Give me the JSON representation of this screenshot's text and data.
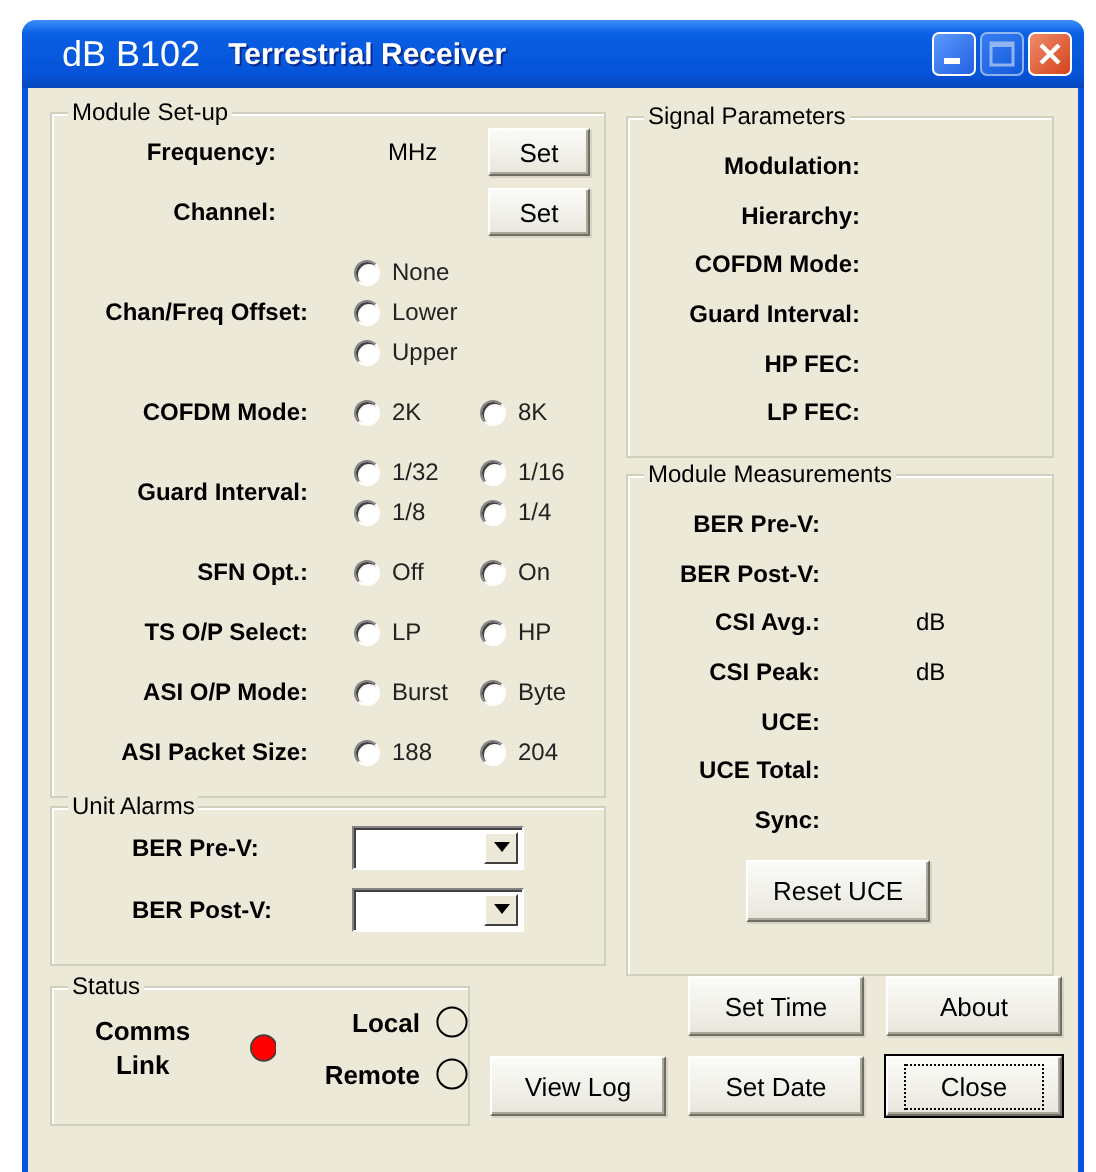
{
  "window": {
    "app_name": "dB B102",
    "title": "Terrestrial Receiver",
    "controls": [
      {
        "kind": "minimize",
        "disabled": false
      },
      {
        "kind": "maximize",
        "disabled": true
      },
      {
        "kind": "close",
        "disabled": false
      }
    ]
  },
  "module_setup": {
    "title": "Module Set-up",
    "rows": [
      {
        "kind": "input",
        "label": "Frequency:",
        "unit": "MHz",
        "button": "Set"
      },
      {
        "kind": "input",
        "label": "Channel:",
        "button": "Set"
      },
      {
        "kind": "radio-stack",
        "label": "Chan/Freq Offset:",
        "options": [
          {
            "label": "None",
            "selected": false
          },
          {
            "label": "Lower",
            "selected": false
          },
          {
            "label": "Upper",
            "selected": false
          }
        ]
      },
      {
        "kind": "radio-grid",
        "label": "COFDM Mode:",
        "options": [
          {
            "label": "2K",
            "selected": false
          },
          {
            "label": "8K",
            "selected": false
          }
        ]
      },
      {
        "kind": "radio-grid",
        "label": "Guard Interval:",
        "options": [
          {
            "label": "1/32",
            "selected": false
          },
          {
            "label": "1/16",
            "selected": false
          },
          {
            "label": "1/8",
            "selected": false
          },
          {
            "label": "1/4",
            "selected": false
          }
        ]
      },
      {
        "kind": "radio-grid",
        "label": "SFN Opt.:",
        "options": [
          {
            "label": "Off",
            "selected": false
          },
          {
            "label": "On",
            "selected": false
          }
        ]
      },
      {
        "kind": "radio-grid",
        "label": "TS O/P Select:",
        "options": [
          {
            "label": "LP",
            "selected": false
          },
          {
            "label": "HP",
            "selected": false
          }
        ]
      },
      {
        "kind": "radio-grid",
        "label": "ASI O/P Mode:",
        "options": [
          {
            "label": "Burst",
            "selected": false
          },
          {
            "label": "Byte",
            "selected": false
          }
        ]
      },
      {
        "kind": "radio-grid",
        "label": "ASI Packet Size:",
        "options": [
          {
            "label": "188",
            "selected": false
          },
          {
            "label": "204",
            "selected": false
          }
        ]
      }
    ]
  },
  "unit_alarms": {
    "title": "Unit Alarms",
    "fields": [
      {
        "label": "BER Pre-V:"
      },
      {
        "label": "BER Post-V:"
      }
    ]
  },
  "signal_parameters": {
    "title": "Signal Parameters",
    "fields": [
      {
        "label": "Modulation:"
      },
      {
        "label": "Hierarchy:"
      },
      {
        "label": "COFDM Mode:"
      },
      {
        "label": "Guard Interval:"
      },
      {
        "label": "HP FEC:"
      },
      {
        "label": "LP FEC:"
      }
    ]
  },
  "module_measurements": {
    "title": "Module Measurements",
    "fields": [
      {
        "label": "BER Pre-V:"
      },
      {
        "label": "BER Post-V:"
      },
      {
        "label": "CSI Avg.:",
        "unit": "dB"
      },
      {
        "label": "CSI Peak:",
        "unit": "dB"
      },
      {
        "label": "UCE:"
      },
      {
        "label": "UCE Total:"
      },
      {
        "label": "Sync:"
      }
    ],
    "button": "Reset UCE"
  },
  "status": {
    "title": "Status",
    "comms_link": {
      "label": "Comms Link",
      "on": true
    },
    "indicators": [
      {
        "label": "Local",
        "selected": false
      },
      {
        "label": "Remote",
        "selected": false
      }
    ]
  },
  "buttons": [
    {
      "label": "Set Time",
      "focused": false
    },
    {
      "label": "About",
      "focused": false
    },
    {
      "label": "View Log",
      "focused": false
    },
    {
      "label": "Set Date",
      "focused": false
    },
    {
      "label": "Close",
      "focused": true
    }
  ]
}
